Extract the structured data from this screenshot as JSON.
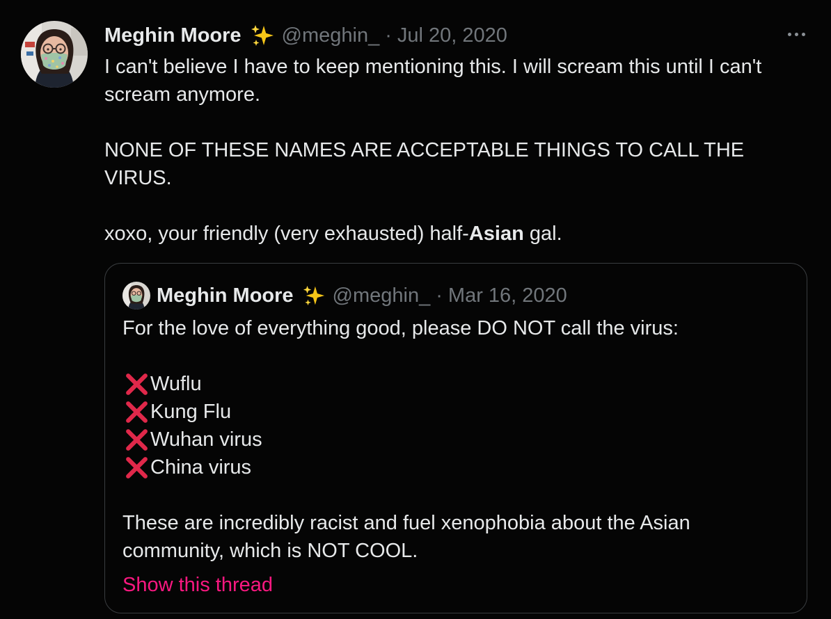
{
  "tweet": {
    "author_name": "Meghin Moore",
    "name_emoji": "sparkles-emoji",
    "handle": "@meghin_",
    "separator": "·",
    "date": "Jul 20, 2020",
    "more_icon": "more-icon",
    "avatar_icon": "avatar",
    "paragraphs": [
      "I can't believe I have to keep mentioning this. I will scream this until I can't scream anymore.",
      "NONE OF THESE NAMES ARE ACCEPTABLE THINGS TO CALL THE VIRUS."
    ],
    "signoff_before": "xoxo, your friendly (very exhausted) half-",
    "signoff_bold": "Asian",
    "signoff_after": " gal."
  },
  "quoted_tweet": {
    "author_name": "Meghin Moore",
    "name_emoji": "sparkles-emoji",
    "handle": "@meghin_",
    "separator": "·",
    "date": "Mar 16, 2020",
    "intro": "For the love of everything good, please DO NOT call the virus:",
    "list_icon": "cross-mark-icon",
    "items": [
      "Wuflu",
      "Kung Flu",
      "Wuhan virus",
      "China virus"
    ],
    "closing": "These are incredibly racist and fuel xenophobia about the Asian community, which is NOT COOL.",
    "show_thread": "Show this thread"
  },
  "colors": {
    "background": "#050505",
    "text": "#e7e9ea",
    "secondary_text": "#71767b",
    "link": "#f91880",
    "border": "#3a3d40",
    "cross_mark": "#e0284a",
    "sparkle": "#f5c518"
  }
}
